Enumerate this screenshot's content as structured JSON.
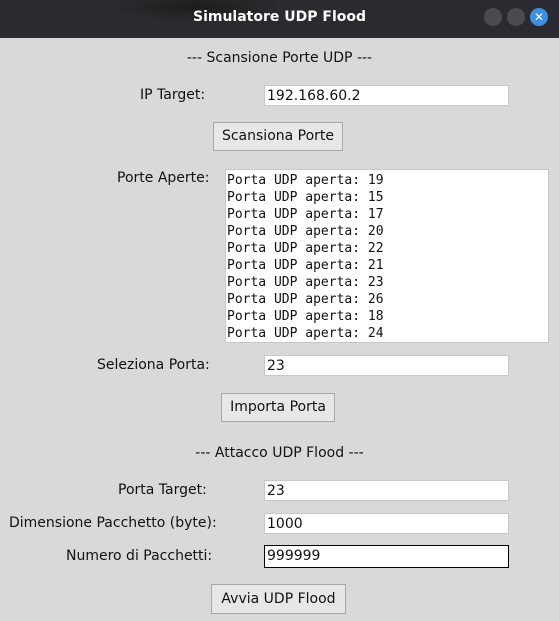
{
  "window": {
    "title": "Simulatore UDP Flood",
    "close_glyph": "✕"
  },
  "scan": {
    "header": "--- Scansione Porte UDP ---",
    "ip_label": "IP Target:",
    "ip_value": "192.168.60.2",
    "scan_button": "Scansiona Porte",
    "open_ports_label": "Porte Aperte:",
    "open_ports": [
      "Porta UDP aperta: 19",
      "Porta UDP aperta: 15",
      "Porta UDP aperta: 17",
      "Porta UDP aperta: 20",
      "Porta UDP aperta: 22",
      "Porta UDP aperta: 21",
      "Porta UDP aperta: 23",
      "Porta UDP aperta: 26",
      "Porta UDP aperta: 18",
      "Porta UDP aperta: 24"
    ],
    "select_port_label": "Seleziona Porta:",
    "select_port_value": "23",
    "import_button": "Importa Porta"
  },
  "attack": {
    "header": "--- Attacco UDP Flood ---",
    "target_port_label": "Porta Target:",
    "target_port_value": "23",
    "packet_size_label": "Dimensione Pacchetto (byte):",
    "packet_size_value": "1000",
    "packet_count_label": "Numero di Pacchetti:",
    "packet_count_value": "999999",
    "start_button": "Avvia UDP Flood"
  },
  "colors": {
    "titlebar": "#2b2b2f",
    "background": "#d9d9d9",
    "close_button": "#3d8fe5"
  }
}
